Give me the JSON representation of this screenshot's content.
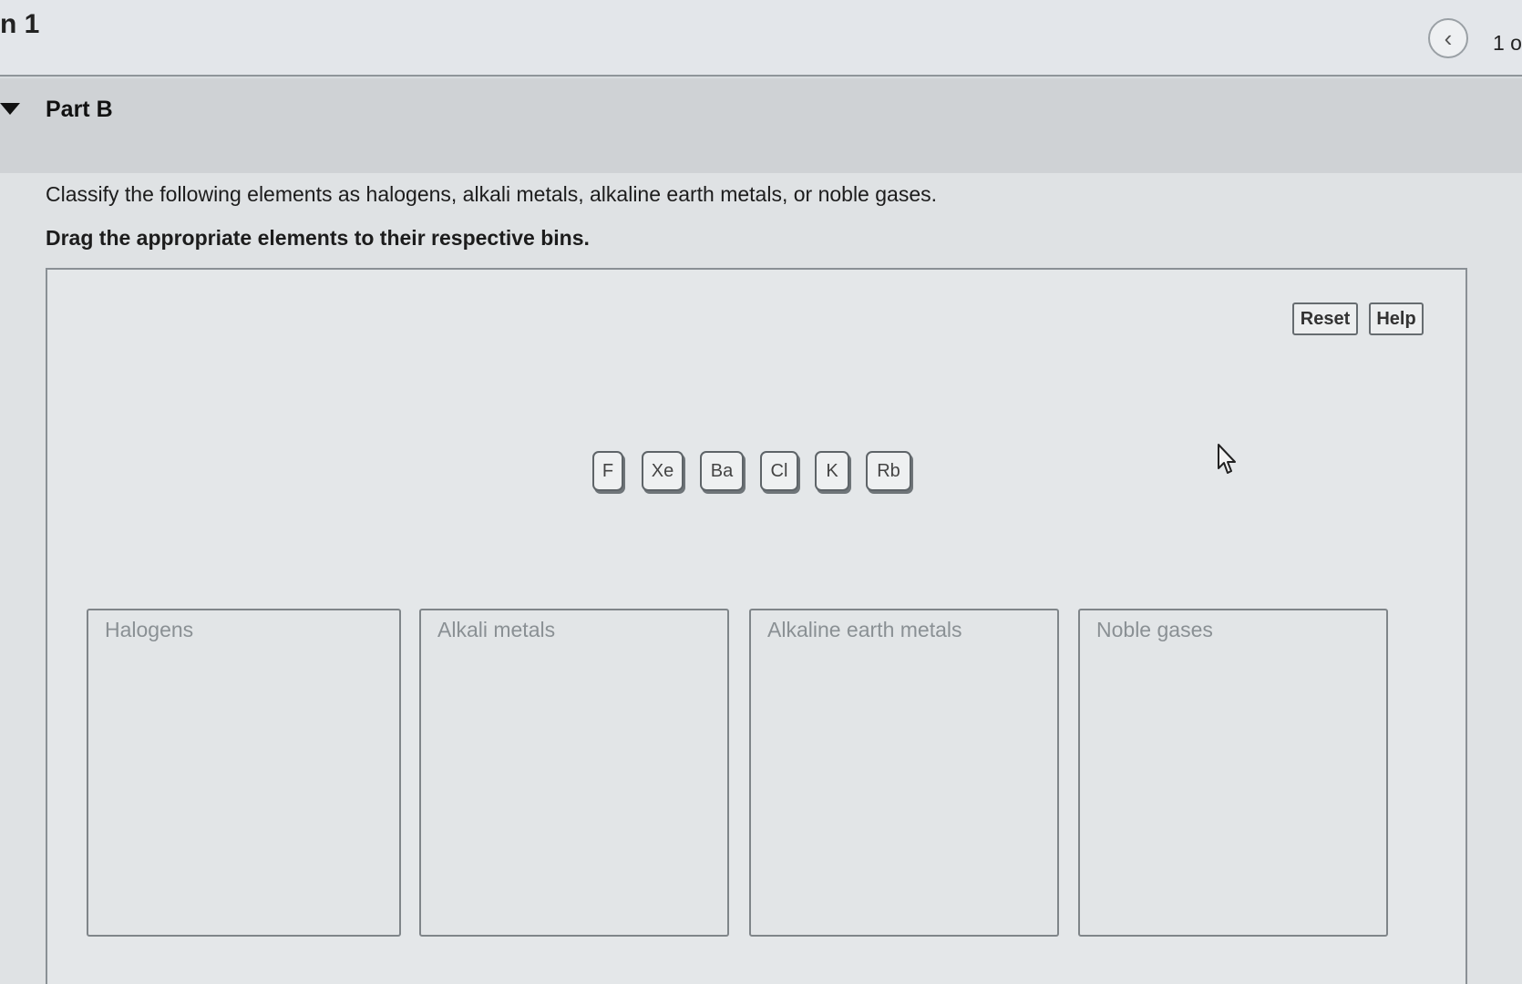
{
  "topbar": {
    "title": "n 1",
    "prev_icon": "chevron-left-icon",
    "page_indicator": "1 o"
  },
  "part": {
    "toggle_icon": "caret-down-icon",
    "title": "Part B"
  },
  "question": {
    "instruction": "Classify the following elements as halogens, alkali metals, alkaline earth metals, or noble gases.",
    "drag_instruction": "Drag the appropriate elements to their respective bins."
  },
  "toolbar": {
    "reset_label": "Reset",
    "help_label": "Help"
  },
  "elements": [
    "F",
    "Xe",
    "Ba",
    "Cl",
    "K",
    "Rb"
  ],
  "bins": [
    {
      "label": "Halogens"
    },
    {
      "label": "Alkali metals"
    },
    {
      "label": "Alkaline earth metals"
    },
    {
      "label": "Noble gases"
    }
  ],
  "cursor_icon": "mouse-pointer-icon"
}
